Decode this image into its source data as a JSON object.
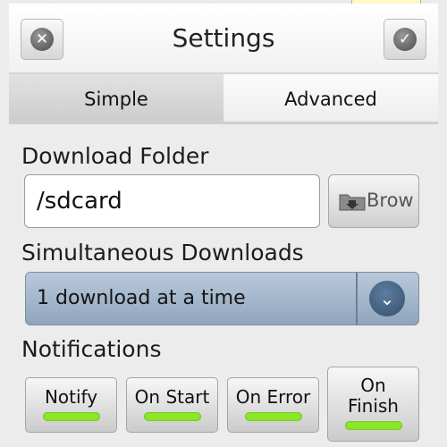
{
  "header": {
    "title": "Settings",
    "cancel_icon": "close-x-icon",
    "confirm_icon": "checkmark-icon"
  },
  "tabs": [
    {
      "label": "Simple",
      "selected": true
    },
    {
      "label": "Advanced",
      "selected": false
    }
  ],
  "download_folder": {
    "label": "Download Folder",
    "value": "/sdcard",
    "browse_label": "Brow",
    "browse_icon": "folder-icon"
  },
  "simultaneous": {
    "label": "Simultaneous Downloads",
    "selected": "1 download at a time",
    "dropdown_icon": "chevron-down-icon"
  },
  "notifications": {
    "label": "Notifications",
    "toggles": [
      {
        "label": "Notify",
        "on": true
      },
      {
        "label": "On Start",
        "on": true
      },
      {
        "label": "On Error",
        "on": true
      },
      {
        "label": "On Finish",
        "on": true
      }
    ]
  },
  "colors": {
    "toggle_on": "#8ee62b",
    "dropdown_bg": "#9fb3c8"
  }
}
